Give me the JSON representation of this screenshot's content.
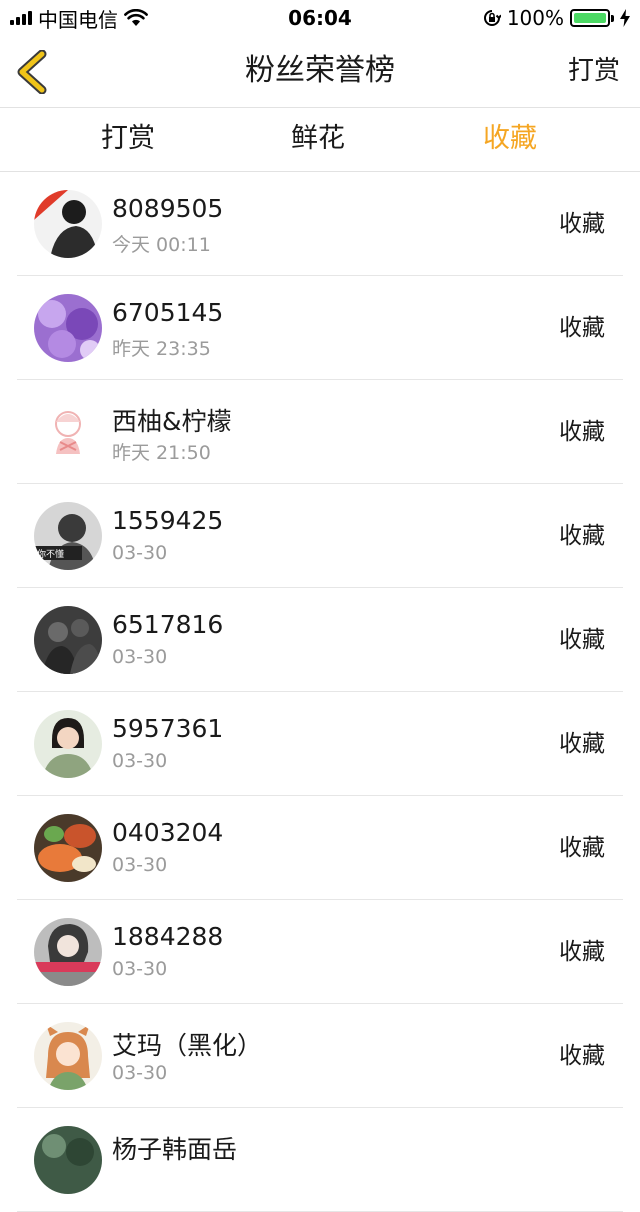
{
  "status_bar": {
    "carrier": "中国电信",
    "time": "06:04",
    "battery": "100%",
    "battery_level": 1.0,
    "icons": [
      "signal-icon",
      "wifi-icon",
      "orientation-lock-icon",
      "battery-icon",
      "charging-icon"
    ]
  },
  "nav": {
    "back_icon": "chevron-left-icon",
    "title": "粉丝荣誉榜",
    "right_label": "打赏"
  },
  "tabs": [
    {
      "label": "打赏",
      "active": false
    },
    {
      "label": "鲜花",
      "active": false
    },
    {
      "label": "收藏",
      "active": true
    }
  ],
  "colors": {
    "accent": "#f5a623",
    "back_icon": "#f0c419",
    "secondary_text": "#9b9b9b",
    "divider": "#e6e6e6",
    "battery": "#4cd964"
  },
  "fans": [
    {
      "name": "8089505",
      "time": "今天 00:11",
      "action": "收藏"
    },
    {
      "name": "6705145",
      "time": "昨天 23:35",
      "action": "收藏"
    },
    {
      "name": "西柚&柠檬",
      "time": "昨天 21:50",
      "action": "收藏"
    },
    {
      "name": "1559425",
      "time": "03-30",
      "action": "收藏",
      "avatar_text": "你不懂"
    },
    {
      "name": "6517816",
      "time": "03-30",
      "action": "收藏"
    },
    {
      "name": "5957361",
      "time": "03-30",
      "action": "收藏"
    },
    {
      "name": "0403204",
      "time": "03-30",
      "action": "收藏"
    },
    {
      "name": "1884288",
      "time": "03-30",
      "action": "收藏"
    },
    {
      "name": "艾玛（黑化）",
      "time": "03-30",
      "action": "收藏"
    },
    {
      "name": "杨子韩面岳",
      "time": "",
      "action": ""
    }
  ]
}
